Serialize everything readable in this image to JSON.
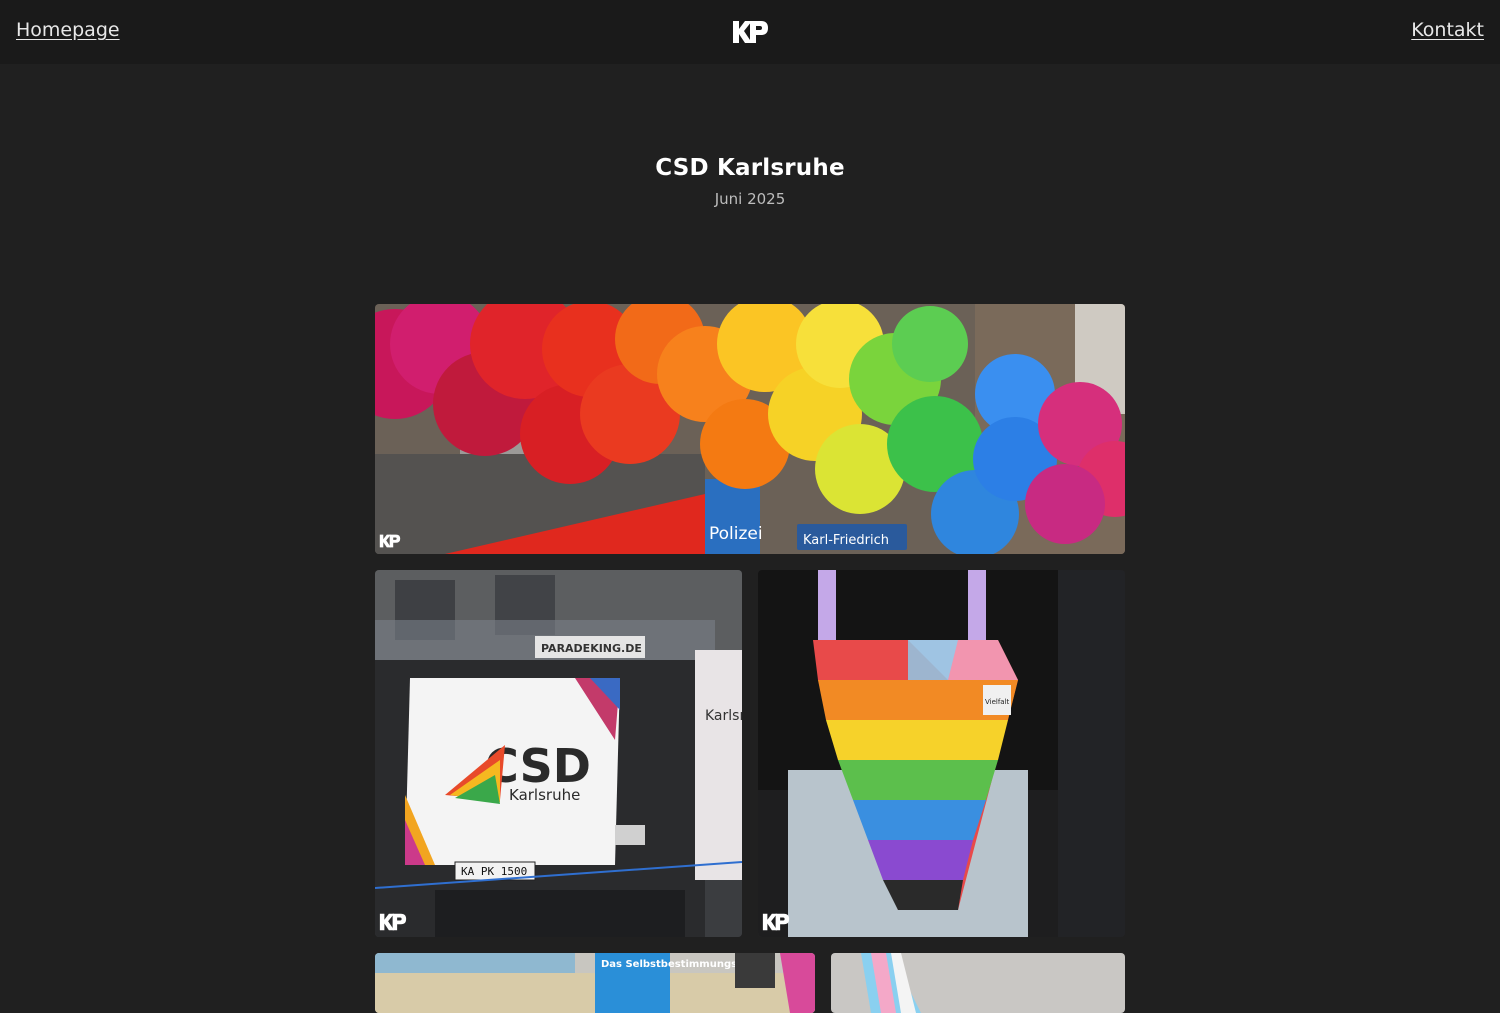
{
  "header": {
    "home_label": "Homepage",
    "contact_label": "Kontakt",
    "logo_text": "KP"
  },
  "event": {
    "title": "CSD Karlsruhe",
    "date": "Juni 2025"
  },
  "gallery": {
    "photos": [
      {
        "subject": "rainbow balloon arch",
        "signs": [
          "Polizei",
          "Karl-Friedrich"
        ]
      },
      {
        "subject": "parade truck with banner",
        "banner_title": "CSD",
        "banner_subtitle": "Karlsruhe",
        "truck_sign": "PARADEKING.DE",
        "plate": "KA PK 1500",
        "side_text": "Karlsruhe"
      },
      {
        "subject": "person carrying rainbow tote bag",
        "tag": "Vielfalt"
      },
      {
        "subject": "crowd with sign",
        "sign_text": "Das Selbstbestimmungs"
      },
      {
        "subject": "pride flag"
      }
    ],
    "watermark": "KP"
  },
  "colors": {
    "background": "#202020",
    "topbar": "#1a1a1a",
    "text": "#f2f2f2",
    "muted": "#bdbdbd"
  }
}
